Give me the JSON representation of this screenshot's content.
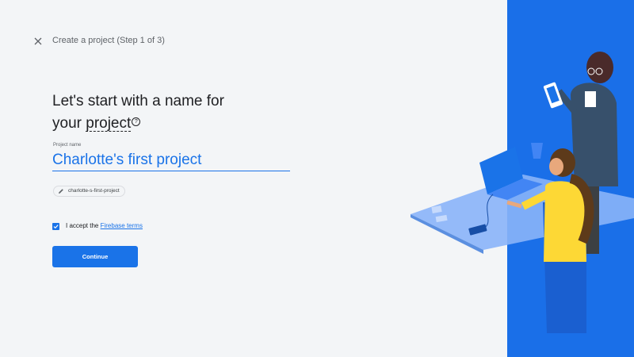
{
  "header": {
    "close_icon": "close-icon",
    "title": "Create a project (Step 1 of 3)"
  },
  "main": {
    "heading_part1": "Let's start with a name for",
    "heading_your": "your",
    "heading_project": "project",
    "help_icon": "help-circle-icon",
    "field_label": "Project name",
    "project_name": "Charlotte's first project",
    "project_id": "charlotte-s-first-project",
    "edit_icon": "pencil-icon",
    "terms_checked": true,
    "terms_prefix": "I accept the",
    "terms_link": "Firebase terms",
    "continue_label": "Continue"
  },
  "colors": {
    "accent": "#1a73e8",
    "panel": "#1a6fe8",
    "background": "#f3f5f7"
  }
}
